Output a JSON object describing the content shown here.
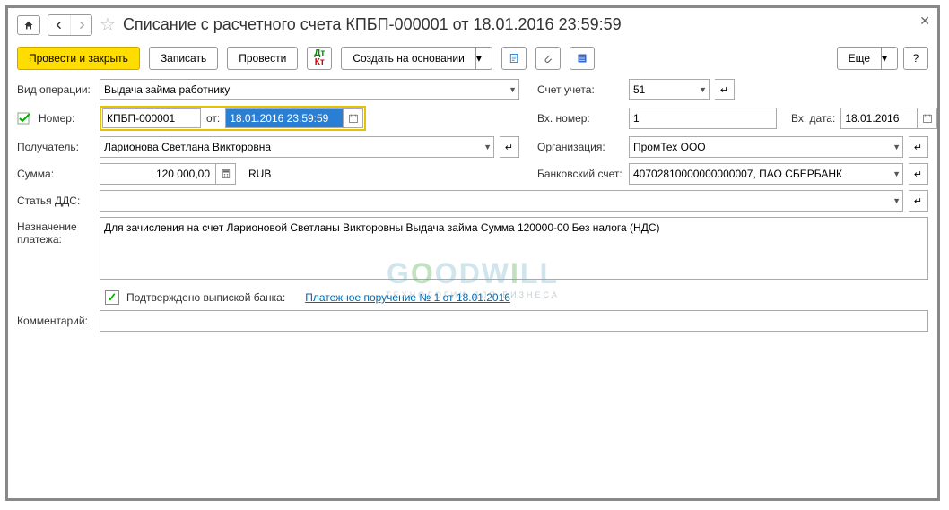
{
  "title": "Списание с расчетного счета КПБП-000001 от 18.01.2016 23:59:59",
  "toolbar": {
    "post_close": "Провести и закрыть",
    "save": "Записать",
    "post": "Провести",
    "create_based": "Создать на основании",
    "more": "Еще"
  },
  "labels": {
    "op_type": "Вид операции:",
    "number": "Номер:",
    "from": "от:",
    "recipient": "Получатель:",
    "amount": "Сумма:",
    "dds": "Статья ДДС:",
    "purpose": "Назначение платежа:",
    "comment": "Комментарий:",
    "account": "Счет учета:",
    "in_number": "Вх. номер:",
    "in_date": "Вх. дата:",
    "org": "Организация:",
    "bank_acc": "Банковский счет:",
    "confirmed": "Подтверждено выпиской банка:",
    "payment_order": "Платежное поручение № 1 от 18.01.2016"
  },
  "values": {
    "op_type": "Выдача займа работнику",
    "number": "КПБП-000001",
    "date": "18.01.2016 23:59:59",
    "recipient": "Ларионова Светлана Викторовна",
    "amount": "120 000,00",
    "currency": "RUB",
    "account": "51",
    "in_number": "1",
    "in_date": "18.01.2016",
    "org": "ПромТех ООО",
    "bank_acc": "40702810000000000007, ПАО СБЕРБАНК",
    "purpose": "Для зачисления на счет Ларионовой Светланы Викторовны Выдача займа Сумма 120000-00 Без налога (НДС)",
    "dds": "",
    "comment": ""
  },
  "watermark": {
    "line1_a": "G",
    "line1_o": "O",
    "line1_b": "ODW",
    "line1_i": "I",
    "line1_c": "LL",
    "line2": "ТЕХНОЛОГИИ ДЛЯ БИЗНЕСА"
  }
}
